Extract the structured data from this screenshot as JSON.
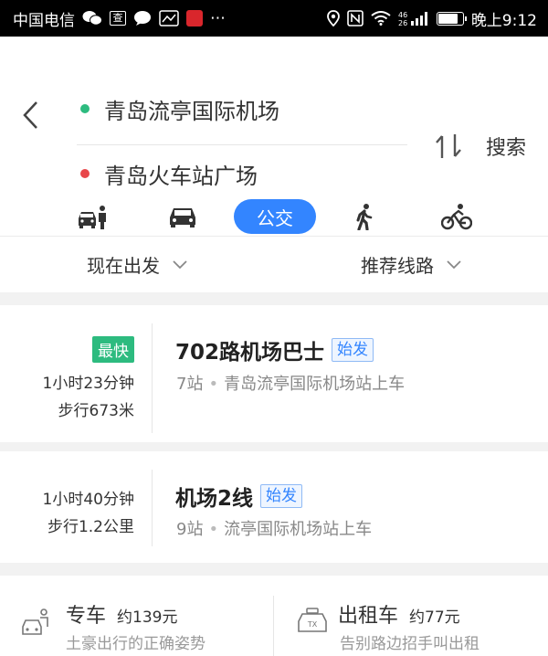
{
  "status_bar": {
    "carrier": "中国电信",
    "search_badge": "查",
    "network": "4G 26",
    "time": "晚上9:12"
  },
  "route": {
    "origin": "青岛流亭国际机场",
    "destination": "青岛火车站广场",
    "search_label": "搜索"
  },
  "modes": {
    "active_label": "公交",
    "items": [
      "drive-taxi",
      "car",
      "bus",
      "walk",
      "bike"
    ]
  },
  "filters": {
    "depart": "现在出发",
    "sort": "推荐线路"
  },
  "results": [
    {
      "badge": "最快",
      "duration": "1小时23分钟",
      "walk": "步行673米",
      "line": "702路机场巴士",
      "tag": "始发",
      "stops": "7站",
      "board": "青岛流亭国际机场站上车"
    },
    {
      "duration": "1小时40分钟",
      "walk": "步行1.2公里",
      "line": "机场2线",
      "tag": "始发",
      "stops": "9站",
      "board": "流亭国际机场站上车"
    }
  ],
  "bottom": {
    "premium": {
      "title": "专车",
      "price": "约139元",
      "sub": "土豪出行的正确姿势"
    },
    "taxi": {
      "title": "出租车",
      "price": "约77元",
      "sub": "告别路边招手叫出租",
      "icon_text": "TX"
    }
  },
  "colors": {
    "accent": "#3385ff",
    "origin_dot": "#2dbb7f",
    "dest_dot": "#e8474a",
    "fast_badge": "#2dbb7f"
  }
}
